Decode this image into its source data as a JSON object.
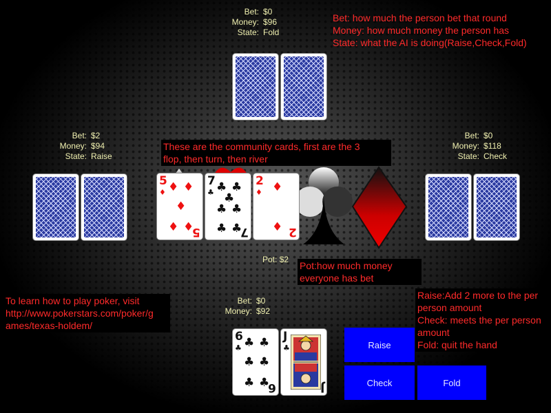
{
  "players": {
    "top": {
      "bet_label": "Bet:",
      "bet": "$0",
      "money_label": "Money:",
      "money": "$96",
      "state_label": "State:",
      "state": "Fold"
    },
    "left": {
      "bet_label": "Bet:",
      "bet": "$2",
      "money_label": "Money:",
      "money": "$94",
      "state_label": "State:",
      "state": "Raise"
    },
    "right": {
      "bet_label": "Bet:",
      "bet": "$0",
      "money_label": "Money:",
      "money": "$118",
      "state_label": "State:",
      "state": "Check"
    },
    "bottom": {
      "bet_label": "Bet:",
      "bet": "$0",
      "money_label": "Money:",
      "money": "$92"
    }
  },
  "pot": {
    "label": "Pot:",
    "value": "$2"
  },
  "community_cards": [
    {
      "rank": "5",
      "suit": "♦",
      "color": "#e11111"
    },
    {
      "rank": "7",
      "suit": "♣",
      "color": "#111111"
    },
    {
      "rank": "2",
      "suit": "♦",
      "color": "#e11111"
    }
  ],
  "player_cards": [
    {
      "rank": "6",
      "suit": "♣",
      "color": "#111111"
    },
    {
      "rank": "J",
      "suit": "♣",
      "color": "#111111"
    }
  ],
  "buttons": {
    "raise": "Raise",
    "check": "Check",
    "fold": "Fold"
  },
  "notes": {
    "stats_help": [
      "Bet: how much the person bet that round",
      "Money: how much money the person has",
      "State: what the AI is doing(Raise,Check,Fold)"
    ],
    "community_help": [
      "These are the community cards, first are the 3",
      "flop, then turn, then river"
    ],
    "pot_help": [
      "Pot:how much money",
      "everyone has bet"
    ],
    "learn": [
      "To learn how to play poker, visit",
      "http://www.pokerstars.com/poker/g",
      "ames/texas-holdem/"
    ],
    "actions_help": [
      "Raise:Add 2 more to the per",
      "person amount",
      "Check: meets the per person",
      "amount",
      "Fold: quit the hand"
    ]
  },
  "colors": {
    "note": "#ff2a2a",
    "stats": "#f0f0b0",
    "button": "#0000ff",
    "card_back": "#2a3aa0"
  }
}
